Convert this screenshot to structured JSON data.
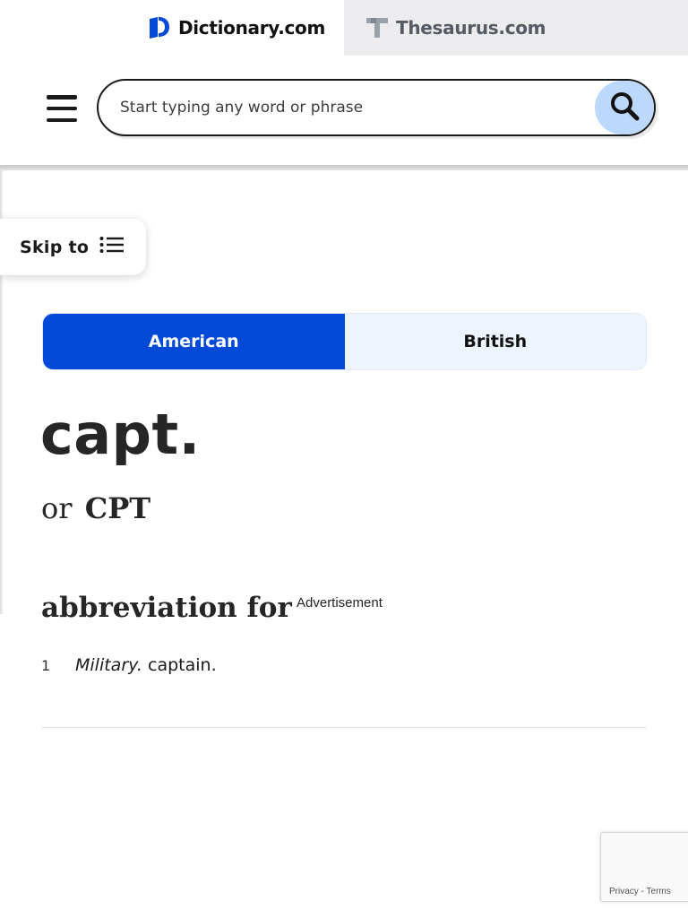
{
  "site_tabs": {
    "dictionary_label": "Dictionary.com",
    "thesaurus_label": "Thesaurus.com"
  },
  "search": {
    "placeholder": "Start typing any word or phrase"
  },
  "skip_to": {
    "label": "Skip to"
  },
  "region_toggle": {
    "options": [
      {
        "label": "American",
        "active": true
      },
      {
        "label": "British",
        "active": false
      }
    ]
  },
  "entry": {
    "headword": "capt.",
    "variant_connector": "or",
    "variant": "CPT",
    "part_of_speech": "abbreviation for",
    "definitions": [
      {
        "number": "1",
        "label": "Military.",
        "text": "captain."
      }
    ]
  },
  "ad": {
    "label": "Advertisement"
  },
  "recaptcha": {
    "privacy": "Privacy",
    "separator": "-",
    "terms": "Terms"
  },
  "colors": {
    "brand_blue": "#0249d8",
    "inactive_tab_bg": "#eef4fd",
    "search_button_bg": "#bcd8fb",
    "thesaurus_tab_bg": "#ececee"
  }
}
